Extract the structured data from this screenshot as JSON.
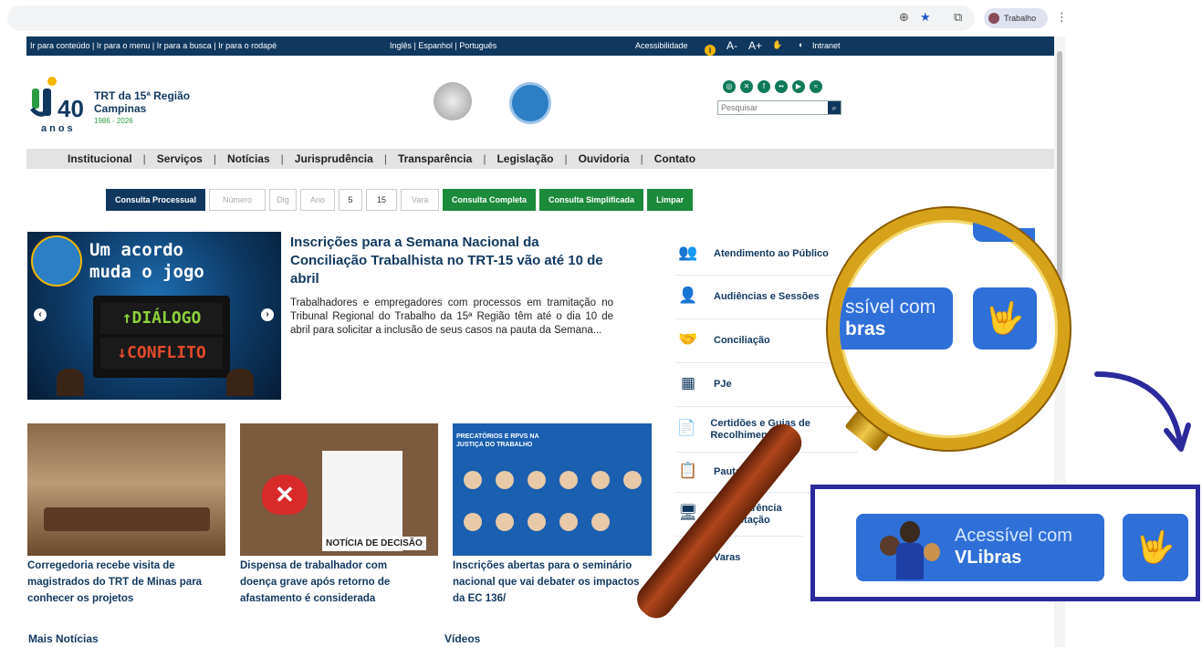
{
  "browser": {
    "profile_label": "Trabalho"
  },
  "topbar": {
    "skip_links": "Ir para conteúdo | Ir para o menu | Ir para a busca | Ir para o rodapé",
    "languages": "Inglês | Espanhol | Português",
    "accessibility_label": "Acessibilidade",
    "font_decrease": "A-",
    "font_increase": "A+",
    "intranet_label": "Intranet"
  },
  "header": {
    "logo_line1": "TRT da 15ª Região",
    "logo_line2": "Campinas",
    "logo_years": "1986 - 2026",
    "logo_anos": "anos",
    "logo_number": "40",
    "search_placeholder": "Pesquisar"
  },
  "nav": {
    "items": [
      "Institucional",
      "Serviços",
      "Notícias",
      "Jurisprudência",
      "Transparência",
      "Legislação",
      "Ouvidoria",
      "Contato"
    ]
  },
  "consulta": {
    "label": "Consulta Processual",
    "fields": [
      "Número",
      "Dig",
      "Ano",
      "5",
      "15",
      "Vara"
    ],
    "btn_completa": "Consulta Completa",
    "btn_simplificada": "Consulta Simplificada",
    "btn_limpar": "Limpar"
  },
  "banner": {
    "line1": "Um acordo",
    "line2": "muda o jogo",
    "up": "↑DIÁLOGO",
    "down": "↓CONFLITO"
  },
  "featured": {
    "title": "Inscrições para a Semana Nacional da Conciliação Trabalhista no TRT-15 vão até 10 de abril",
    "summary": "Trabalhadores e empregadores com processos em tramitação no Tribunal Regional do Trabalho da 15ª Região têm até o dia 10 de abril para solicitar a inclusão de seus casos na pauta da Semana..."
  },
  "news": [
    {
      "caption": "Corregedoria recebe visita de magistrados do TRT de Minas para conhecer os projetos"
    },
    {
      "caption": "Dispensa de trabalhador com doença grave após retorno de afastamento é considerada",
      "tag": "NOTÍCIA DE DECISÃO"
    },
    {
      "caption": "Inscrições abertas para o seminário nacional que vai debater os impactos da EC 136/",
      "img_title": "PRECATÓRIOS E RPVS NA JUSTIÇA DO TRABALHO"
    }
  ],
  "sections": {
    "more_news": "Mais Notícias",
    "videos": "Vídeos"
  },
  "services": [
    {
      "label": "Atendimento ao Público",
      "icon": "people-icon"
    },
    {
      "label": "Audiências e Sessões",
      "icon": "meeting-icon"
    },
    {
      "label": "Conciliação",
      "icon": "handshake-icon"
    },
    {
      "label": "PJe",
      "icon": "chip-icon"
    },
    {
      "label": "Certidões e Guias de Recolhimento",
      "icon": "certificate-icon"
    },
    {
      "label": "Pautas",
      "icon": "clipboard-icon"
    },
    {
      "label": "Transparência e Prestação",
      "icon": "monitor-icon"
    },
    {
      "label": "Varas",
      "icon": "building-icon"
    }
  ],
  "vlibras": {
    "line1": "Acessível com",
    "line2": "VLibras",
    "mag_line1": "ssível com",
    "mag_line2": "bras"
  },
  "colors": {
    "navy": "#10385f",
    "green": "#1b8a3a",
    "vlibras_blue": "#2f6fd8",
    "highlight_border": "#2b2a9c"
  }
}
